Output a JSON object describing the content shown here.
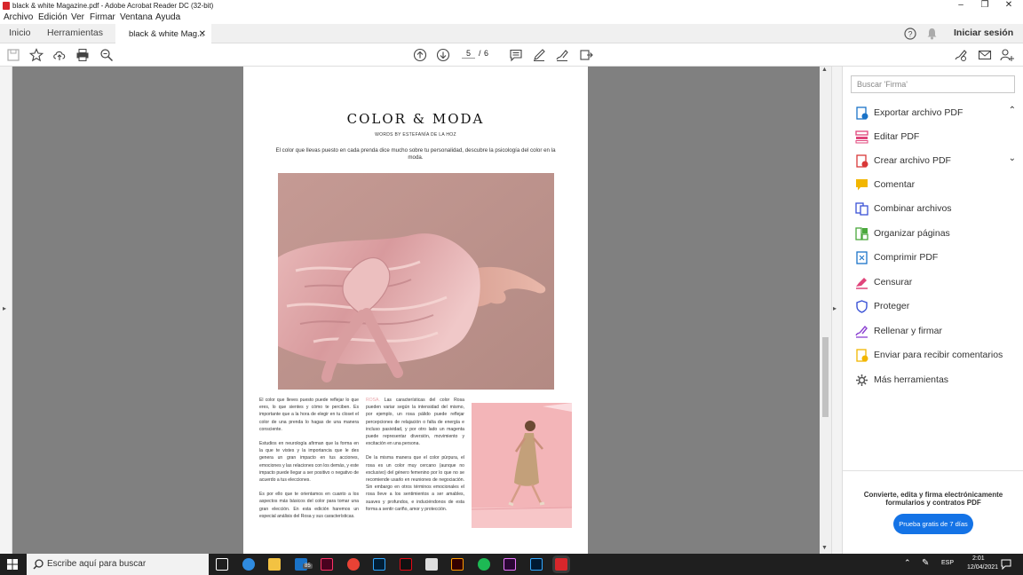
{
  "window": {
    "title": "black & white Magazine.pdf - Adobe Acrobat Reader DC (32-bit)"
  },
  "menu": [
    "Archivo",
    "Edición",
    "Ver",
    "Firmar",
    "Ventana",
    "Ayuda"
  ],
  "tabs": {
    "home": "Inicio",
    "tools": "Herramientas",
    "document": "black & white Mag...",
    "signin": "Iniciar sesión"
  },
  "toolbar": {
    "page_current": "5",
    "page_separator": "/",
    "page_total": "6"
  },
  "document": {
    "title": "COLOR & MODA",
    "byline": "WORDS BY  ESTEFANÍA DE LA HOZ",
    "intro": "El color que llevas puesto en cada prenda dice mucho sobre tu personalidad, descubre la psicología del color en la moda.",
    "col1_p1": "El color que lleves puesto puede reflejar lo que eres, lo que sientes y cómo te perciben. Es importante que a la hora de elegir en tu closet el color de una prenda lo hagas de una manera consciente.",
    "col1_p2": "Estudios en neurología afirman que la forma en la que te vistes y la importancia que le des genera un gran impacto en tus acciones, emociones y las relaciones con los demás, y este impacto puede llegar a ser positivo o negativo de acuerdo a tus elecciones.",
    "col1_p3": "Es por ello que te orientamos en cuanto a los aspectos más básicos del color para tomar una gran elección. En esta edición haremos un especial análisis del Rosa y sus características.",
    "col2_accent": "ROSA.",
    "col2_p1": " Las características del color Rosa pueden variar según la intensidad del mismo, por ejemplo, un rosa pálido puede reflejar percepciones de relajación o falta de energía e incluso pasividad, y por otro lado un magenta puede representar diversión, movimiento y excitación en una persona.",
    "col2_p2": "De la misma manera que el color púrpura, el rosa es un color muy cercano (aunque no exclusivo) del género femenino por lo que no se recomiende usarlo en reuniones de negociación. Sin embargo en otros términos emocionales el rosa lleve a los sentimientos a ser amables, suaves y profundos, e induciéndonos de esta forma a sentir cariño, amor y protección."
  },
  "right_panel": {
    "search_placeholder": "Buscar 'Firma'",
    "tools": [
      {
        "label": "Exportar archivo PDF",
        "icon": "export-pdf-icon",
        "color": "#1a73c8"
      },
      {
        "label": "Editar PDF",
        "icon": "edit-pdf-icon",
        "color": "#e0457b"
      },
      {
        "label": "Crear archivo PDF",
        "icon": "create-pdf-icon",
        "color": "#d93838"
      },
      {
        "label": "Comentar",
        "icon": "comment-icon",
        "color": "#f2b600"
      },
      {
        "label": "Combinar archivos",
        "icon": "combine-files-icon",
        "color": "#3a52d6"
      },
      {
        "label": "Organizar páginas",
        "icon": "organize-pages-icon",
        "color": "#4aa83c"
      },
      {
        "label": "Comprimir PDF",
        "icon": "compress-pdf-icon",
        "color": "#1a73c8"
      },
      {
        "label": "Censurar",
        "icon": "redact-icon",
        "color": "#e0457b"
      },
      {
        "label": "Proteger",
        "icon": "protect-icon",
        "color": "#3a52d6"
      },
      {
        "label": "Rellenar y firmar",
        "icon": "fill-sign-icon",
        "color": "#8a3fd1"
      },
      {
        "label": "Enviar para recibir comentarios",
        "icon": "send-review-icon",
        "color": "#f2b600"
      },
      {
        "label": "Más herramientas",
        "icon": "more-tools-icon",
        "color": "#555555"
      }
    ],
    "promo_text": "Convierte, edita y firma electrónicamente formularios y contratos PDF",
    "promo_button": "Prueba gratis de 7 días"
  },
  "taskbar": {
    "search_placeholder": "Escribe aquí para buscar",
    "language": "ESP",
    "time": "2:01",
    "date": "12/04/2021",
    "mail_badge": "85"
  },
  "colors": {
    "accent": "#1473e6",
    "doc_background": "#808080",
    "photo_pink": "#c89b9a"
  }
}
